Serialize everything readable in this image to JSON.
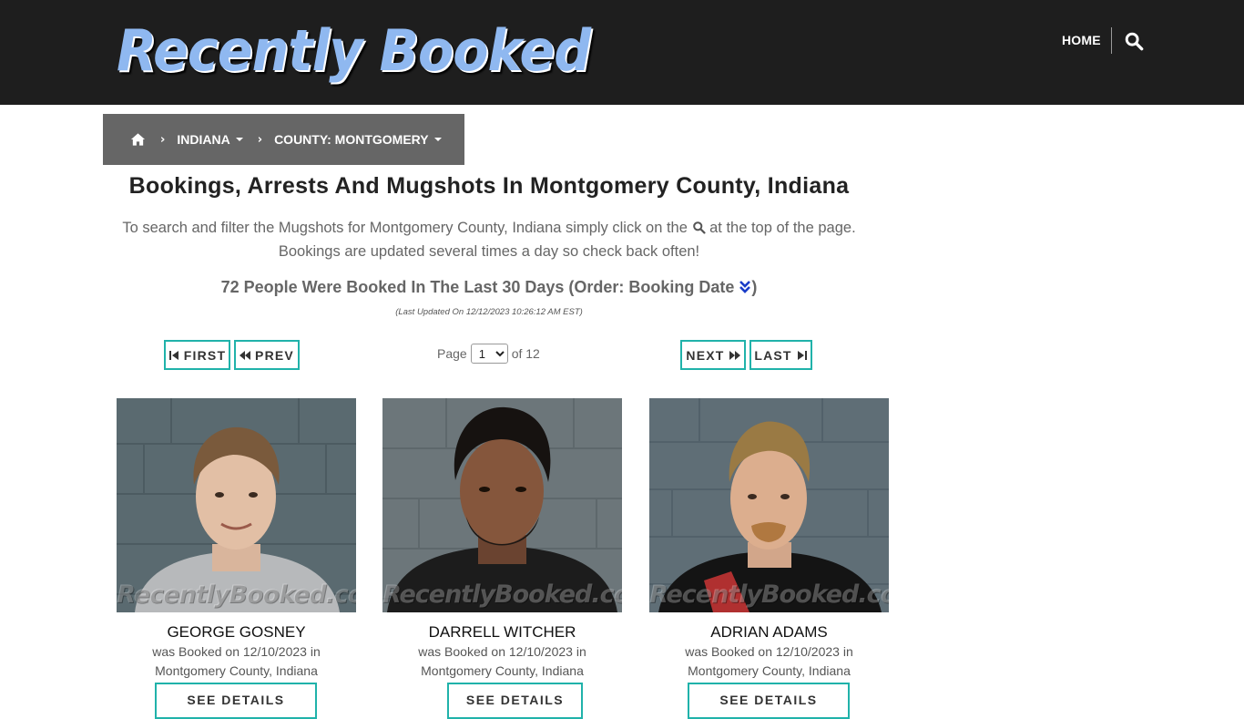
{
  "site": {
    "logo_text": "Recently Booked",
    "home_label": "HOME"
  },
  "breadcrumb": {
    "state_label": "INDIANA",
    "county_label": "COUNTY: MONTGOMERY"
  },
  "page": {
    "title": "Bookings, Arrests And Mugshots In Montgomery County, Indiana",
    "intro_before": "To search and filter the Mugshots for Montgomery County, Indiana simply click on the",
    "intro_after": "at the top of the page.",
    "intro_line2": "Bookings are updated several times a day so check back often!",
    "count_text": "72 People Were Booked In The Last 30 Days (Order: Booking Date",
    "count_close": ")",
    "updated": "(Last Updated On 12/12/2023 10:26:12 AM EST)"
  },
  "pagination": {
    "first": "FIRST",
    "prev": "PREV",
    "next": "NEXT",
    "last": "LAST",
    "page_label": "Page",
    "current_page": "1",
    "of_label": "of 12"
  },
  "bookings": [
    {
      "name": "GEORGE GOSNEY",
      "line1": "was Booked on 12/10/2023 in",
      "line2": "Montgomery County, Indiana",
      "watermark": "RecentlyBooked.com",
      "button": "SEE DETAILS"
    },
    {
      "name": "DARRELL WITCHER",
      "line1": "was Booked on 12/10/2023 in",
      "line2": "Montgomery County, Indiana",
      "watermark": "RecentlyBooked.com",
      "button": "SEE DETAILS"
    },
    {
      "name": "ADRIAN ADAMS",
      "line1": "was Booked on 12/10/2023 in",
      "line2": "Montgomery County, Indiana",
      "watermark": "RecentlyBooked.com",
      "button": "SEE DETAILS"
    }
  ],
  "colors": {
    "header_bg": "#1e1e1e",
    "breadcrumb_bg": "#666666",
    "accent": "#20b2aa",
    "order_icon": "#1a3cc8"
  },
  "icons": {
    "search": "search-icon",
    "home": "home-icon",
    "order": "double-chevron-down-icon"
  }
}
